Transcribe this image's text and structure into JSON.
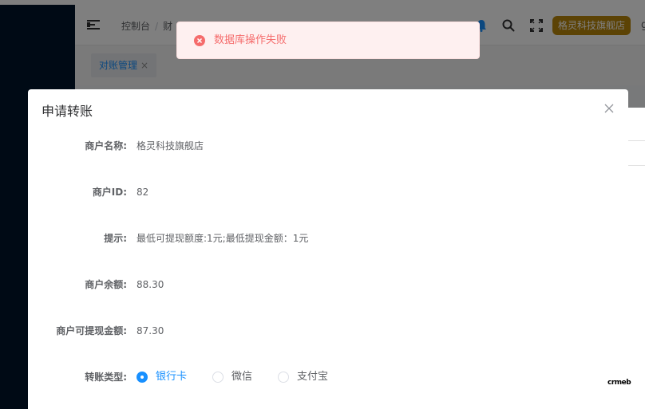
{
  "header": {
    "breadcrumb": [
      "控制台",
      "财"
    ],
    "store_name": "格灵科技旗舰店",
    "user_initial": "g"
  },
  "tags": [
    {
      "label": "对账管理"
    }
  ],
  "toast": {
    "message": "数据库操作失败",
    "type": "error"
  },
  "dialog": {
    "title": "申请转账",
    "fields": [
      {
        "label": "商户名称:",
        "value": "格灵科技旗舰店"
      },
      {
        "label": "商户ID:",
        "value": "82"
      },
      {
        "label": "提示:",
        "value": "最低可提现额度:1元;最低提现金额：1元"
      },
      {
        "label": "商户余额:",
        "value": "88.30"
      },
      {
        "label": "商户可提现金额:",
        "value": "87.30"
      }
    ],
    "transfer_type": {
      "label": "转账类型:",
      "options": [
        "银行卡",
        "微信",
        "支付宝"
      ],
      "selected": "银行卡"
    }
  },
  "watermark": "crmeb",
  "colors": {
    "sidebar": "#00142a",
    "primary": "#1890ff",
    "error": "#f56c6c",
    "store_badge": "#b8860b"
  }
}
